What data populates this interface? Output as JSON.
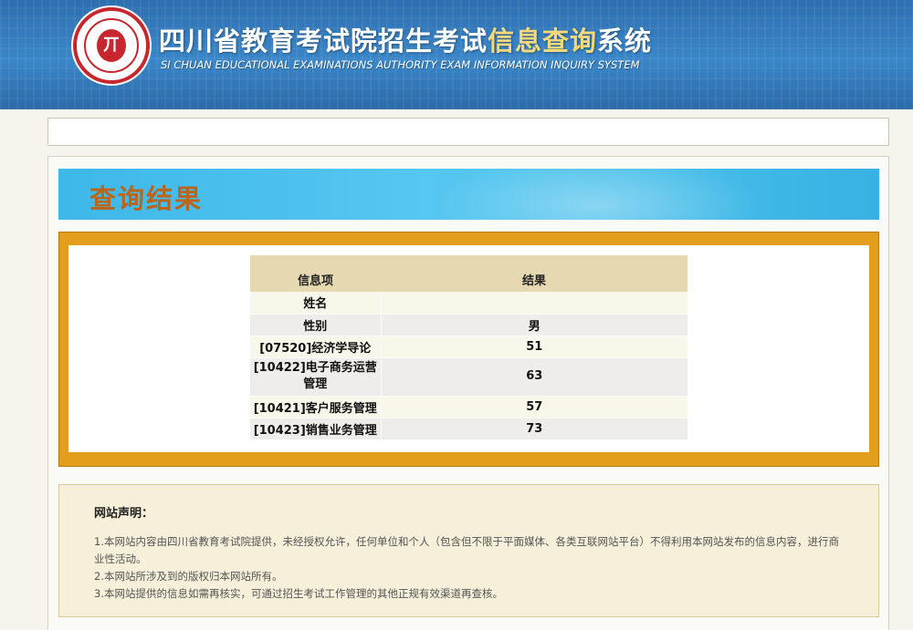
{
  "header": {
    "title_main": "四川省教育考试院招生考试",
    "title_highlight": "信息查询",
    "title_tail": "系统",
    "subtitle": "SI CHUAN EDUCATIONAL EXAMINATIONS AUTHORITY EXAM INFORMATION INQUIRY SYSTEM",
    "logo_char": "丌"
  },
  "banner": {
    "title": "查询结果"
  },
  "results": {
    "headers": {
      "item": "信息项",
      "result": "结果"
    },
    "rows": [
      {
        "item": "姓名",
        "value": ""
      },
      {
        "item": "性别",
        "value": "男"
      },
      {
        "item": "[07520]经济学导论",
        "value": "51"
      },
      {
        "item": "[10422]电子商务运营管理",
        "value": "63"
      },
      {
        "item": "[10421]客户服务管理",
        "value": "57"
      },
      {
        "item": "[10423]销售业务管理",
        "value": "73"
      }
    ]
  },
  "notice": {
    "title": "网站声明：",
    "lines": [
      "1.本网站内容由四川省教育考试院提供，未经授权允许，任何单位和个人（包含但不限于平面媒体、各类互联网站平台）不得利用本网站发布的信息内容，进行商业性活动。",
      "2.本网站所涉及到的版权归本网站所有。",
      "3.本网站提供的信息如需再核实，可通过招生考试工作管理的其他正规有效渠道再查核。"
    ]
  },
  "colors": {
    "header_blue": "#3a86c8",
    "banner_blue": "#46bde9",
    "banner_text": "#b8661c",
    "frame_gold": "#e29e1c",
    "table_header": "#e6d9b2"
  }
}
